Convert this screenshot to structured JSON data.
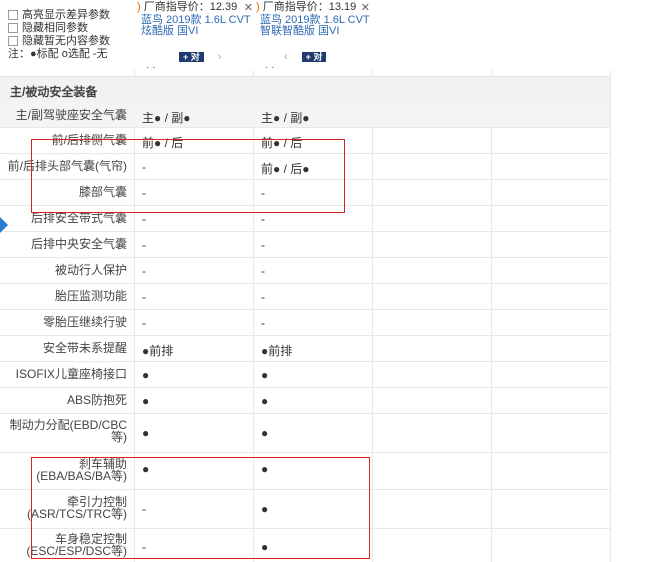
{
  "header": {
    "options": [
      {
        "label": "高亮显示差异参数"
      },
      {
        "label": "隐藏相同参数"
      },
      {
        "label": "隐藏暂无内容参数"
      }
    ],
    "legend": "注：●标配 o选配 -无"
  },
  "cars": [
    {
      "price_label": "厂商指导价：",
      "price": "12.39",
      "name": "蓝鸟 2019款 1.6L CVT炫酷版 国VI",
      "compare": "+ 对",
      "arrow_right": "›",
      "arrow_left": "",
      "cut": "· ·"
    },
    {
      "price_label": "厂商指导价：",
      "price": "13.19",
      "name": "蓝鸟 2019款 1.6L CVT智联智酷版 国VI",
      "compare": "+ 对",
      "arrow_right": "",
      "arrow_left": "‹",
      "cut": "· ·"
    }
  ],
  "section": {
    "title": "主/被动安全装备"
  },
  "rows": [
    {
      "label": "主/副驾驶座安全气囊",
      "v1": "主● / 副●",
      "v2": "主● / 副●",
      "hl": true
    },
    {
      "label": "前/后排侧气囊",
      "v1": "前● / 后",
      "v2": "前● / 后"
    },
    {
      "label": "前/后排头部气囊(气帘)",
      "v1": "-",
      "v2": "前● / 后●"
    },
    {
      "label": "膝部气囊",
      "v1": "-",
      "v2": "-"
    },
    {
      "label": "后排安全带式气囊",
      "v1": "-",
      "v2": "-"
    },
    {
      "label": "后排中央安全气囊",
      "v1": "-",
      "v2": "-"
    },
    {
      "label": "被动行人保护",
      "v1": "-",
      "v2": "-"
    },
    {
      "label": "胎压监测功能",
      "v1": "-",
      "v2": "-"
    },
    {
      "label": "零胎压继续行驶",
      "v1": "-",
      "v2": "-"
    },
    {
      "label": "安全带未系提醒",
      "v1": "●前排",
      "v2": "●前排"
    },
    {
      "label": "ISOFIX儿童座椅接口",
      "v1": "●",
      "v2": "●"
    },
    {
      "label": "ABS防抱死",
      "v1": "●",
      "v2": "●"
    },
    {
      "label": "制动力分配(EBD/CBC等)",
      "v1": "●",
      "v2": "●"
    },
    {
      "label": "刹车辅助(EBA/BAS/BA等)",
      "v1": "●",
      "v2": "●"
    },
    {
      "label": "牵引力控制(ASR/TCS/TRC等)",
      "v1": "-",
      "v2": "●"
    },
    {
      "label": "车身稳定控制(ESC/ESP/DSC等)",
      "v1": "-",
      "v2": "●"
    }
  ],
  "colors": {
    "accent": "#2d6bb5",
    "price": "#e36b00",
    "highlight_box": "#dd2222",
    "arrow": "#2b7cd3"
  }
}
